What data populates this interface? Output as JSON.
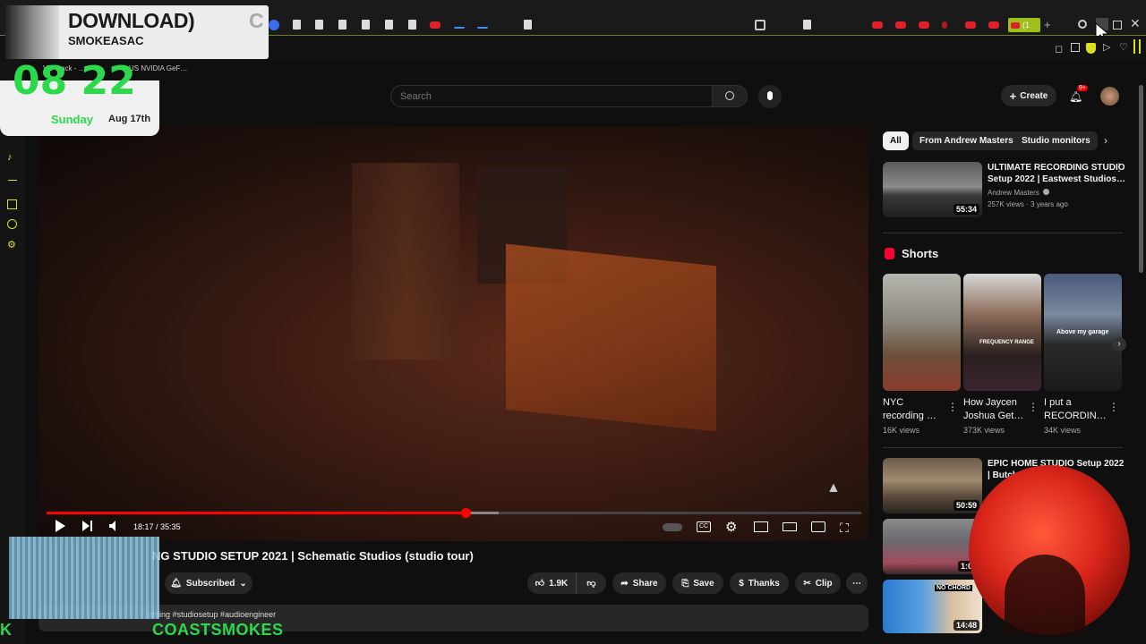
{
  "browser": {
    "tab_icons": [
      "chrome-icon",
      "doc-icon",
      "doc-icon",
      "doc-icon",
      "doc-icon",
      "doc-icon",
      "youtube-icon",
      "chart-icon",
      "chart-icon",
      "doc-icon",
      "qr-icon",
      "doc-icon",
      "youtube-icon",
      "youtube-icon",
      "youtube-icon",
      "youtube-icon",
      "youtube-icon",
      "youtube-icon"
    ],
    "active_tab_label": "(1",
    "new_tab": "+",
    "bookmarks": [
      "VE Track - …",
      "…US NVIDIA GeF…"
    ]
  },
  "overlay": {
    "stream_title": "DOWNLOAD)",
    "stream_title_cut": "C",
    "stream_name": "SMOKEASAC",
    "clock_time": "08 22",
    "clock_day": "Sunday",
    "clock_date": "Aug 17th",
    "bottom_ticker": "K",
    "bottom_ticker_2": "COASTSMOKES",
    "accent_green": "#2bd94a"
  },
  "youtube": {
    "search_placeholder": "Search",
    "create_label": "Create",
    "notif_badge": "9+",
    "video": {
      "current_time": "18:17",
      "total_time": "35:35",
      "time_sep": " / ",
      "progress_fraction": 0.514,
      "buffer_fraction": 0.555,
      "title": "NG STUDIO SETUP 2021 | Schematic Studios (studio tour)",
      "subscribed_label": "Subscribed",
      "likes": "1.9K",
      "share_label": "Share",
      "save_label": "Save",
      "thanks_label": "Thanks",
      "clip_label": "Clip",
      "description_preview": "ording #studiosetup #audioengineer"
    },
    "chips": [
      "All",
      "From Andrew Masters",
      "Studio monitors"
    ],
    "recommendations": [
      {
        "title_line1": "ULTIMATE RECORDING STUDIO",
        "title_line2": "Setup 2022 | Eastwest Studios…",
        "channel": "Andrew Masters",
        "meta": "257K views · 3 years ago",
        "duration": "55:34"
      },
      {
        "title_line1": "EPIC HOME STUDIO Setup 2022",
        "title_line2": "| Butch W…",
        "channel": "",
        "meta": "",
        "duration": "50:59"
      },
      {
        "title_line1": "",
        "title_line2": "",
        "channel": "",
        "meta": "",
        "duration": "1:05"
      },
      {
        "title_line1": "",
        "title_line2": "",
        "channel": "",
        "meta": "",
        "duration": "14:48"
      }
    ],
    "shorts_label": "Shorts",
    "shorts": [
      {
        "title_line1": "NYC",
        "title_line2": "recording …",
        "views": "16K views",
        "overlay_text": ""
      },
      {
        "title_line1": "How Jaycen",
        "title_line2": "Joshua Get…",
        "views": "373K views",
        "overlay_text": "FREQUENCY RANGE"
      },
      {
        "title_line1": "I put a",
        "title_line2": "RECORDIN…",
        "views": "34K views",
        "overlay_text": "Above my garage"
      }
    ],
    "thumb_label_4": "NO CHORD"
  }
}
